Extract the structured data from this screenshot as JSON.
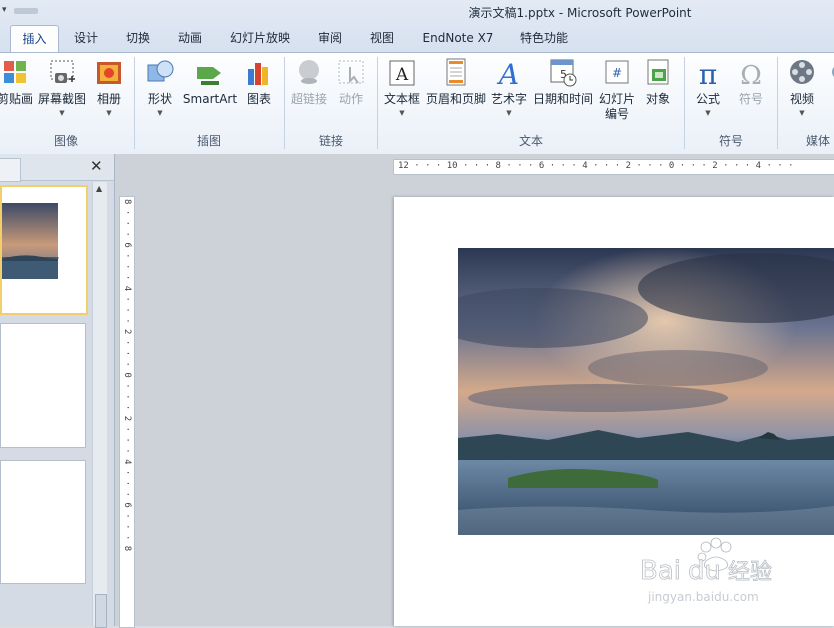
{
  "window": {
    "title": "演示文稿1.pptx  -  Microsoft PowerPoint"
  },
  "tabs": [
    "插入",
    "设计",
    "切换",
    "动画",
    "幻灯片放映",
    "审阅",
    "视图",
    "EndNote X7",
    "特色功能"
  ],
  "ribbon": {
    "groups": {
      "images": "图像",
      "illustrations": "插图",
      "links": "链接",
      "text": "文本",
      "symbols": "符号",
      "media": "媒体"
    },
    "buttons": {
      "clipart": "剪贴画",
      "screenshot": "屏幕截图",
      "album": "相册",
      "shapes": "形状",
      "smartart": "SmartArt",
      "chart": "图表",
      "hyperlink": "超链接",
      "action": "动作",
      "textbox": "文本框",
      "header_footer": "页眉和页脚",
      "wordart": "艺术字",
      "datetime": "日期和时间",
      "slide_number": "幻灯片\n编号",
      "object": "对象",
      "equation": "公式",
      "symbol": "符号",
      "video": "视频"
    }
  },
  "icon_glyphs": {
    "equation": "π",
    "symbol": "Ω",
    "slide_number": "#",
    "wordart": "A",
    "textbox": "A"
  },
  "rulers": {
    "horizontal": "12 · · · 10 · · · 8 · · · 6 · · · 4 · · · 2 · · · 0 · · · 2 · · · 4 · · ·",
    "vertical": "8 · · · 6 · · · 4 · · · 2 · · · 0 · · · 2 · · · 4 · · · 6 · · · 8"
  },
  "watermark": {
    "brand": "Bai",
    "brand2": "du",
    "cn": "经验",
    "url": "jingyan.baidu.com"
  },
  "colors": {
    "accent": "#15428b",
    "selected_thumb": "#f2cf6a"
  }
}
